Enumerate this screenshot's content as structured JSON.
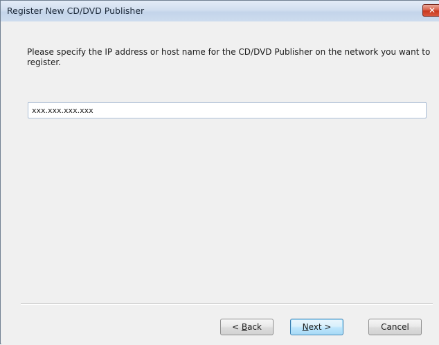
{
  "window": {
    "title": "Register New CD/DVD Publisher",
    "close_glyph": "✕"
  },
  "main": {
    "instruction": "Please specify the IP address or host name for the CD/DVD Publisher on the network you want to register.",
    "address_value": "xxx.xxx.xxx.xxx"
  },
  "buttons": {
    "back": {
      "prefix": "< ",
      "mnemonic": "B",
      "rest": "ack"
    },
    "next": {
      "mnemonic": "N",
      "rest": "ext >"
    },
    "cancel": "Cancel"
  },
  "colors": {
    "title_bar": "#d1deef",
    "close_button": "#c9391f",
    "default_button_border": "#3c7fb1"
  }
}
